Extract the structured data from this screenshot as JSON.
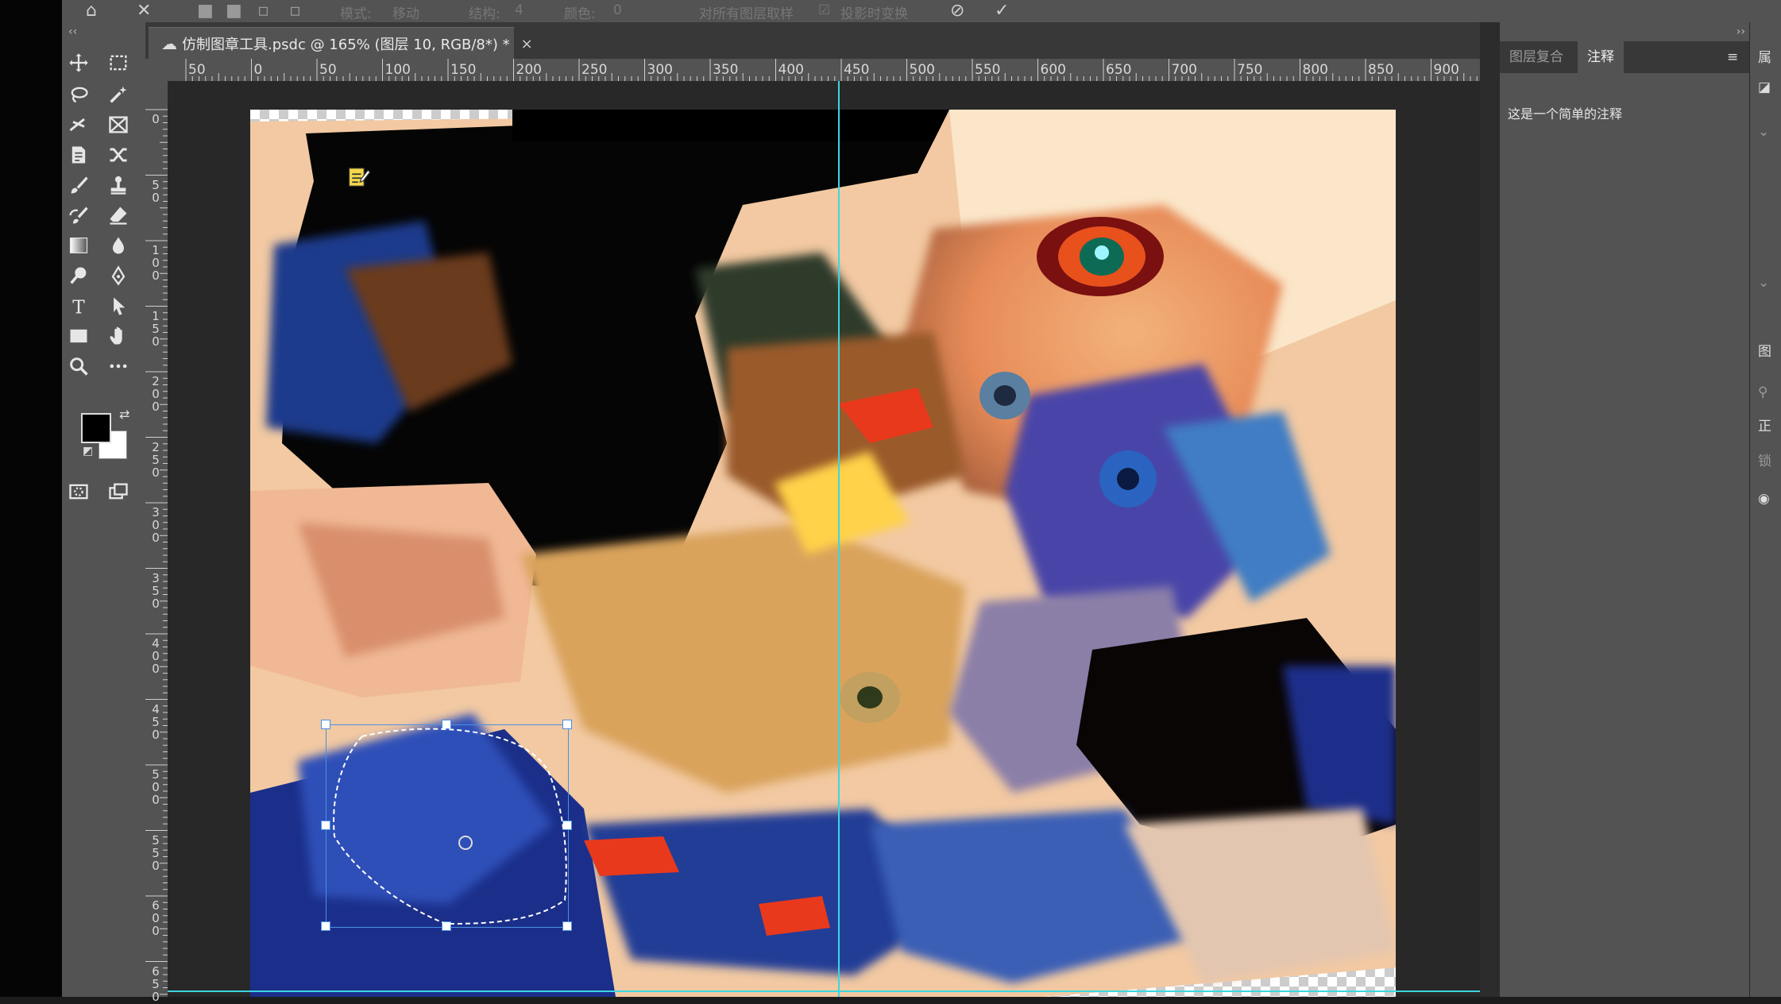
{
  "options_bar": {
    "mode_label": "模式:",
    "mode_value": "移动",
    "structure_label": "结构:",
    "structure_value": "4",
    "color_label": "颜色:",
    "color_value": "0",
    "sample_all_layers": "对所有图层取样",
    "transform_on_drop": "投影时变换"
  },
  "document": {
    "tab_title": "仿制图章工具.psdc @ 165% (图层 10, RGB/8*) *",
    "close_glyph": "×"
  },
  "toolbar": {
    "collapse_glyph": "‹‹",
    "tools": [
      "move-tool",
      "marquee-tool",
      "lasso-tool",
      "magic-wand-tool",
      "crop-tool",
      "frame-tool",
      "eyedropper-tool",
      "healing-tool",
      "brush-tool",
      "clone-stamp-tool",
      "history-brush-tool",
      "eraser-tool",
      "gradient-tool",
      "blur-tool",
      "dodge-tool",
      "pen-tool",
      "type-tool",
      "path-selection-tool",
      "rectangle-tool",
      "hand-tool",
      "zoom-tool",
      "more-tools"
    ],
    "foreground_color": "#000000",
    "background_color": "#ffffff"
  },
  "rulers": {
    "horizontal": [
      "50",
      "0",
      "50",
      "100",
      "150",
      "200",
      "250",
      "300",
      "350",
      "400",
      "450",
      "500",
      "550",
      "600",
      "650",
      "700",
      "750",
      "800",
      "850",
      "900"
    ],
    "vertical": [
      "0",
      "50",
      "100",
      "150",
      "200",
      "250",
      "300",
      "350",
      "400",
      "450",
      "500",
      "550",
      "600",
      "650"
    ]
  },
  "right_panel": {
    "collapse_glyph": "››",
    "tabs": [
      "图层复合",
      "注释"
    ],
    "active_tab": "注释",
    "menu_glyph": "≡",
    "note_text": "这是一个简单的注释"
  },
  "far_right": {
    "properties_label": "属",
    "layers_label": "图",
    "normal_label": "正",
    "lock_label": "锁"
  },
  "colors": {
    "guide": "#3cd6e0",
    "selection_box": "#4a90e2",
    "panel_bg": "#535353"
  }
}
